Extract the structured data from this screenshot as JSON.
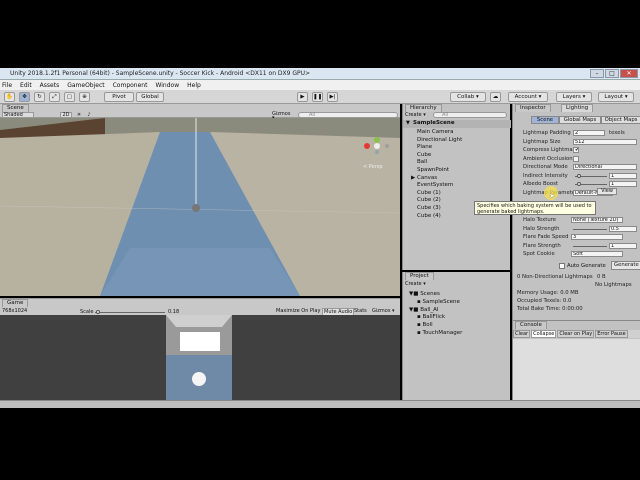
{
  "window": {
    "title": "Unity 2018.1.2f1 Personal (64bit) - SampleScene.unity - Soccer Kick - Android <DX11 on DX9 GPU>",
    "minimize": "–",
    "maximize": "□",
    "close": "✕"
  },
  "menu": [
    "File",
    "Edit",
    "Assets",
    "GameObject",
    "Component",
    "Window",
    "Help"
  ],
  "toolbar": {
    "pivot": "Pivot",
    "global": "Global",
    "collab": "Collab ▾",
    "account": "Account ▾",
    "layers": "Layers ▾",
    "layout": "Layout ▾"
  },
  "scene": {
    "tab": "Scene",
    "shading": "Shaded",
    "mode2d": "2D",
    "gizmos": "Gizmos ▾",
    "search_placeholder": "All",
    "persp": "< Persp"
  },
  "game": {
    "tab": "Game",
    "resolution": "768x1024",
    "scale_label": "Scale",
    "scale_value": "0.18",
    "maximize": "Maximize On Play",
    "mute": "Mute Audio",
    "stats": "Stats",
    "gizmos": "Gizmos ▾"
  },
  "hierarchy": {
    "tab": "Hierarchy",
    "create": "Create ▾",
    "search_placeholder": "All",
    "scene": "SampleScene",
    "items": [
      "Main Camera",
      "Directional Light",
      "Plane",
      "Cube",
      "Ball",
      "SpawnPoint",
      "Canvas",
      "EventSystem",
      "Cube (1)",
      "Cube (2)",
      "Cube (3)",
      "Cube (4)"
    ]
  },
  "project": {
    "tab": "Project",
    "create": "Create ▾",
    "folders": [
      {
        "name": "Scenes",
        "indent": 0
      },
      {
        "name": "SampleScene",
        "indent": 1
      },
      {
        "name": "Ball_AI",
        "indent": 0
      },
      {
        "name": "BallFlick",
        "indent": 1
      },
      {
        "name": "Boll",
        "indent": 1
      },
      {
        "name": "TouchManager",
        "indent": 1
      }
    ]
  },
  "inspector": {
    "tab": "Inspector",
    "lighting_tab": "Lighting",
    "subtabs": [
      "Scene",
      "Global Maps",
      "Object Maps"
    ],
    "fields": [
      {
        "label": "Lightmap Padding",
        "value": "2",
        "unit": "texels"
      },
      {
        "label": "Lightmap Size",
        "value": "512"
      },
      {
        "label": "Compress Lightmaps",
        "value": "✔"
      },
      {
        "label": "Ambient Occlusion",
        "value": ""
      },
      {
        "label": "Directional Mode",
        "value": "Directional"
      },
      {
        "label": "Indirect Intensity",
        "value": "1"
      },
      {
        "label": "Albedo Boost",
        "value": "1"
      },
      {
        "label": "Lightmap Parameters",
        "value": "Default-Medium"
      }
    ],
    "view_btn": "View",
    "tooltip": "Specifies which baking system will be used to generate baked lightmaps.",
    "lower_fields": [
      {
        "label": "Halo Texture",
        "value": "None (Texture 2D)"
      },
      {
        "label": "Halo Strength",
        "value": "0.5"
      },
      {
        "label": "Flare Fade Speed",
        "value": "3"
      },
      {
        "label": "Flare Strength",
        "value": "1"
      },
      {
        "label": "Spot Cookie",
        "value": "Soft"
      }
    ],
    "auto_generate": "Auto Generate",
    "generate": "Generate Lighting",
    "stats": [
      {
        "label": "0 Non-Directional Lightmaps",
        "value": "0 B"
      },
      {
        "label": "",
        "value": "No Lightmaps"
      },
      {
        "label": "Memory Usage: 0.0 MB",
        "value": ""
      },
      {
        "label": "Occupied Texels: 0.0",
        "value": ""
      },
      {
        "label": "Total Bake Time: 0:00:00",
        "value": ""
      }
    ]
  },
  "console": {
    "tab": "Console",
    "buttons": [
      "Clear",
      "Collapse",
      "Clear on Play",
      "Error Pause"
    ]
  },
  "colors": {
    "titlebar": "#dbe6f3",
    "panel": "#c2c2c2",
    "floor": "#6f8fb0",
    "wall": "#b7b1a0",
    "tooltip_bg": "#ffffe1",
    "highlight": "#f5e04a"
  }
}
